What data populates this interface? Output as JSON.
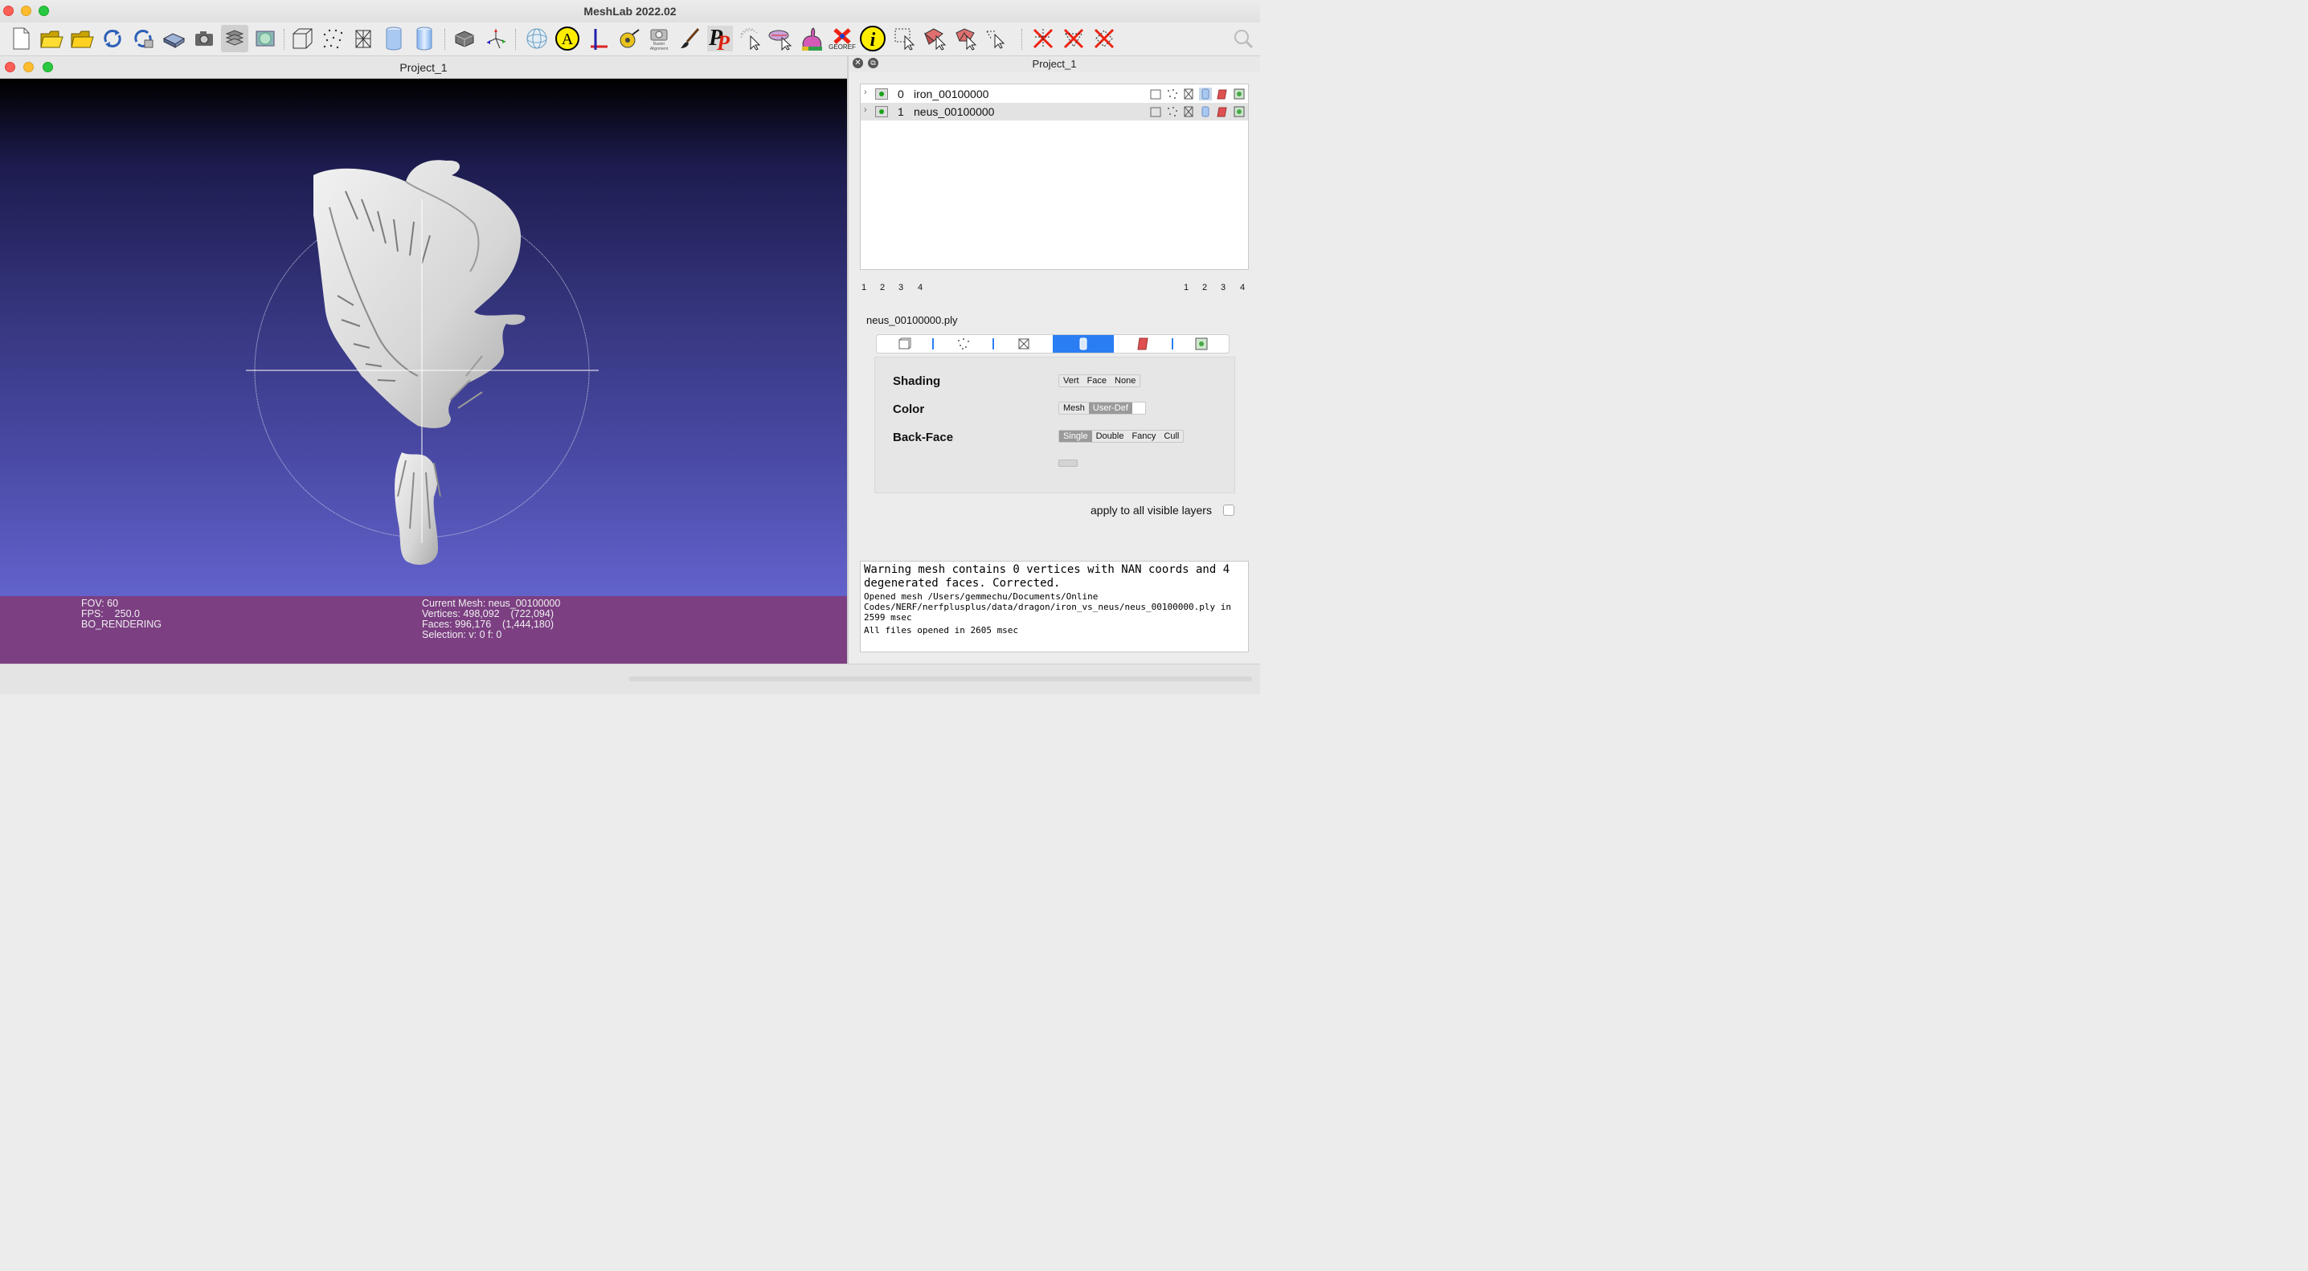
{
  "app": {
    "title": "MeshLab 2022.02"
  },
  "toolbar": {
    "georef_label": "GEOREF",
    "raster_label": "Raster Alignment"
  },
  "document": {
    "title": "Project_1"
  },
  "viewport": {
    "fov": "FOV: 60",
    "fps": "FPS:    250.0",
    "rendering": "BO_RENDERING",
    "current_mesh": "Current Mesh: neus_00100000",
    "vertices": "Vertices: 498,092    (722,094)",
    "faces": "Faces: 996,176    (1,444,180)",
    "selection": "Selection: v: 0 f: 0"
  },
  "layer_panel": {
    "title": "Project_1",
    "layers": [
      {
        "index": "0",
        "name": "iron_00100000"
      },
      {
        "index": "1",
        "name": "neus_00100000"
      }
    ],
    "pager_left": [
      "1",
      "2",
      "3",
      "4"
    ],
    "pager_right": [
      "1",
      "2",
      "3",
      "4"
    ],
    "selected_file": "neus_00100000.ply"
  },
  "render_options": {
    "shading": {
      "label": "Shading",
      "options": [
        "Vert",
        "Face",
        "None"
      ]
    },
    "color": {
      "label": "Color",
      "options": [
        "Mesh",
        "User-Def"
      ],
      "selected": "User-Def"
    },
    "backface": {
      "label": "Back-Face",
      "options": [
        "Single",
        "Double",
        "Fancy",
        "Cull"
      ],
      "selected": "Single"
    },
    "apply_label": "apply to all visible layers"
  },
  "log": {
    "warning": "Warning mesh contains 0 vertices with NAN coords and 4 degenerated faces. Corrected.",
    "opened": "Opened mesh /Users/gemmechu/Documents/Online Codes/NERF/nerfplusplus/data/dragon/iron_vs_neus/neus_00100000.ply in 2599 msec",
    "all_opened": "All files opened in 2605 msec"
  }
}
